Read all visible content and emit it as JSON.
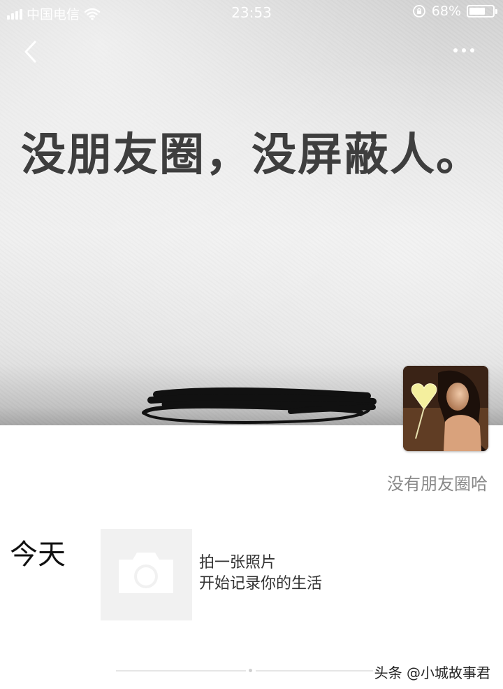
{
  "status_bar": {
    "carrier": "中国电信",
    "time": "23:53",
    "battery": "68%",
    "battery_level": 0.68
  },
  "nav": {
    "back_icon": "chevron-left-icon",
    "more_icon": "more-dots-icon"
  },
  "cover": {
    "text": "没朋友圈，没屏蔽人。"
  },
  "profile": {
    "signature": "没有朋友圈哈"
  },
  "feed": {
    "day_label": "今天",
    "prompt_line1": "拍一张照片",
    "prompt_line2": "开始记录你的生活",
    "camera_icon": "camera-icon"
  },
  "watermark": "头条 @小城故事君"
}
